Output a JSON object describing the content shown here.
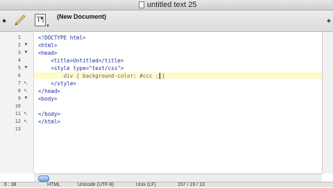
{
  "window": {
    "title": "untitled text 25"
  },
  "toolbar": {
    "document_label": "(New Document)"
  },
  "editor": {
    "lines": [
      {
        "n": "1",
        "text": "<!DOCTYPE html>"
      },
      {
        "n": "2",
        "text": "<html>"
      },
      {
        "n": "3",
        "text": "<head>"
      },
      {
        "n": "4",
        "text": "    <title>Untitled</title>"
      },
      {
        "n": "5",
        "text": "    <style type=\"text/css\">"
      },
      {
        "n": "6",
        "text": "        div { background-color: #ccc ; }"
      },
      {
        "n": "7",
        "text": "    </style>"
      },
      {
        "n": "8",
        "text": "</head>"
      },
      {
        "n": "9",
        "text": "<body>"
      },
      {
        "n": "10",
        "text": ""
      },
      {
        "n": "11",
        "text": "</body>"
      },
      {
        "n": "12",
        "text": "</html>"
      },
      {
        "n": "13",
        "text": ""
      }
    ]
  },
  "status": {
    "cursor": "6 : 38",
    "language": "HTML",
    "encoding": "Unicode (UTF-8)",
    "line_endings": "Unix (LF)",
    "counts": "157 / 19 / 13"
  },
  "colors": {
    "tag": "#1c2fa3",
    "string": "#2f6b2f",
    "highlight": "#fbfbd0"
  }
}
